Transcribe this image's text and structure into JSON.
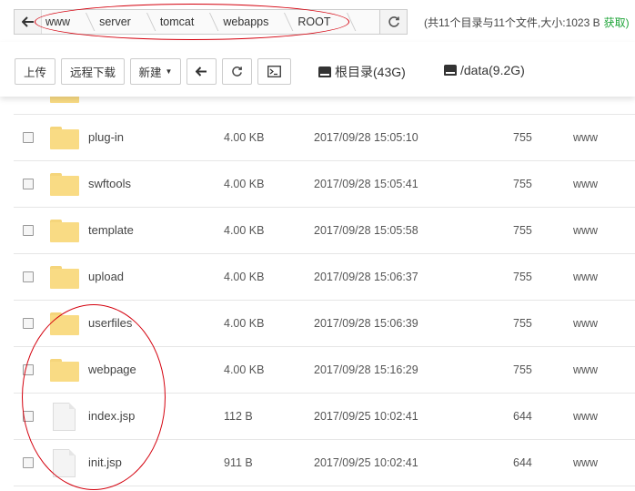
{
  "breadcrumb": {
    "items": [
      "www",
      "server",
      "tomcat",
      "webapps",
      "ROOT"
    ]
  },
  "stats": {
    "text": "(共11个目录与11个文件,大小:1023 B",
    "link": "获取)"
  },
  "toolbar": {
    "upload": "上传",
    "remote_download": "远程下载",
    "new": "新建",
    "disks": [
      {
        "label": "根目录(43G)"
      },
      {
        "label": "/data(9.2G)"
      }
    ]
  },
  "files": [
    {
      "name": "plug-in",
      "type": "folder",
      "size": "4.00 KB",
      "time": "2017/09/28 15:05:10",
      "perm": "755",
      "owner": "www"
    },
    {
      "name": "swftools",
      "type": "folder",
      "size": "4.00 KB",
      "time": "2017/09/28 15:05:41",
      "perm": "755",
      "owner": "www"
    },
    {
      "name": "template",
      "type": "folder",
      "size": "4.00 KB",
      "time": "2017/09/28 15:05:58",
      "perm": "755",
      "owner": "www"
    },
    {
      "name": "upload",
      "type": "folder",
      "size": "4.00 KB",
      "time": "2017/09/28 15:06:37",
      "perm": "755",
      "owner": "www"
    },
    {
      "name": "userfiles",
      "type": "folder",
      "size": "4.00 KB",
      "time": "2017/09/28 15:06:39",
      "perm": "755",
      "owner": "www"
    },
    {
      "name": "webpage",
      "type": "folder",
      "size": "4.00 KB",
      "time": "2017/09/28 15:16:29",
      "perm": "755",
      "owner": "www"
    },
    {
      "name": "index.jsp",
      "type": "file",
      "size": "112 B",
      "time": "2017/09/25 10:02:41",
      "perm": "644",
      "owner": "www"
    },
    {
      "name": "init.jsp",
      "type": "file",
      "size": "911 B",
      "time": "2017/09/25 10:02:41",
      "perm": "644",
      "owner": "www"
    }
  ],
  "colors": {
    "folder": "#f9db84",
    "annotation": "#d4000d",
    "link": "#20a53a"
  }
}
